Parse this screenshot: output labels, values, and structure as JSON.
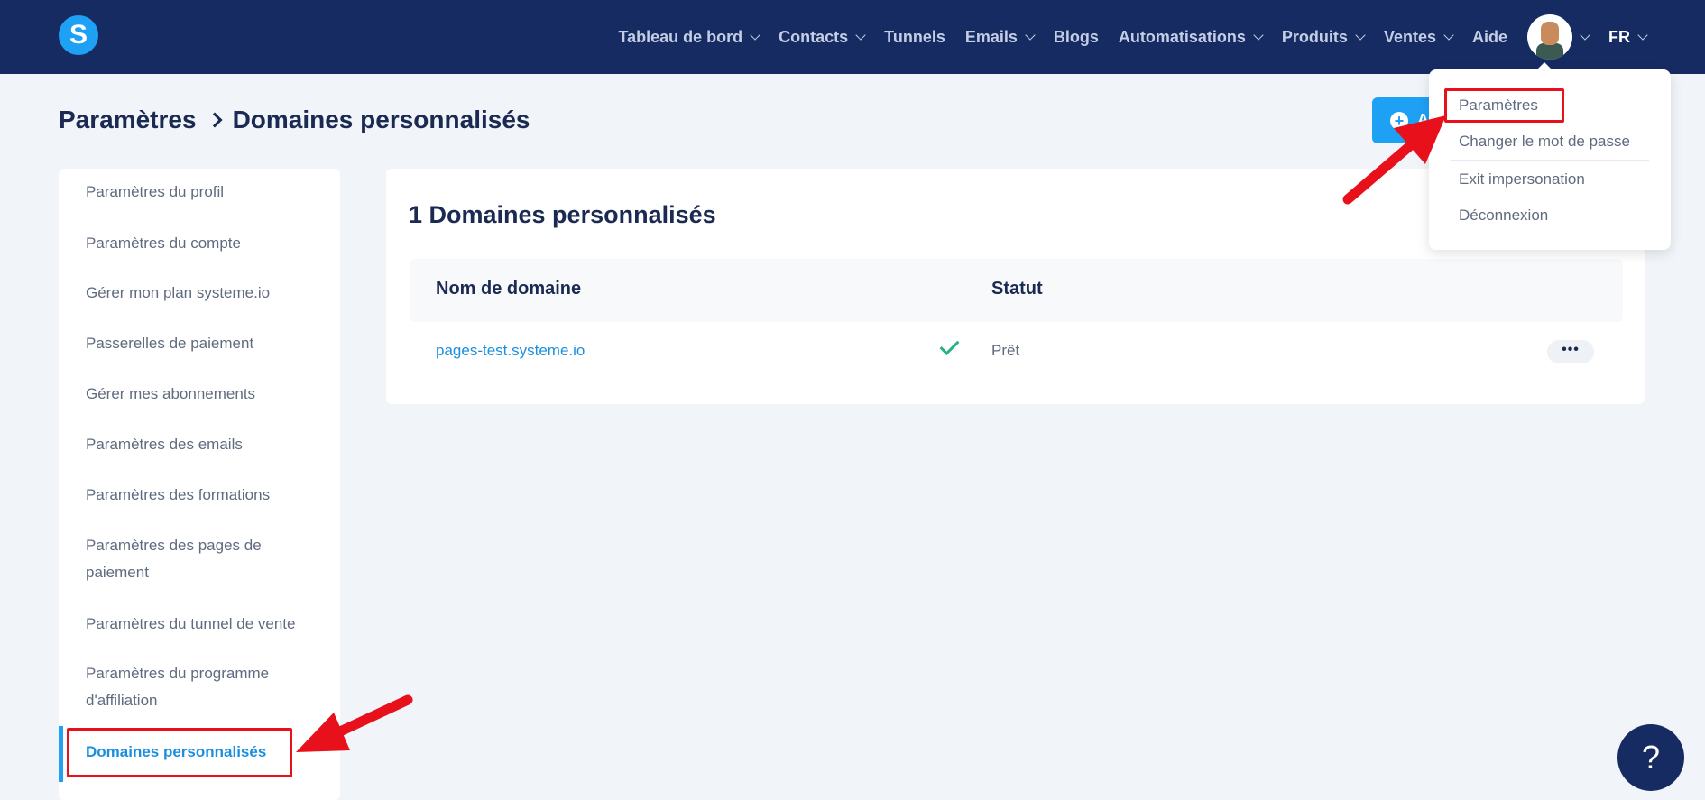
{
  "nav": {
    "logo": "S",
    "items": [
      {
        "label": "Tableau de bord",
        "dropdown": true
      },
      {
        "label": "Contacts",
        "dropdown": true
      },
      {
        "label": "Tunnels",
        "dropdown": false
      },
      {
        "label": "Emails",
        "dropdown": true
      },
      {
        "label": "Blogs",
        "dropdown": false
      },
      {
        "label": "Automatisations",
        "dropdown": true
      },
      {
        "label": "Produits",
        "dropdown": true
      },
      {
        "label": "Ventes",
        "dropdown": true
      },
      {
        "label": "Aide",
        "dropdown": false
      }
    ],
    "language": "FR"
  },
  "breadcrumb": {
    "parent": "Paramètres",
    "current": "Domaines personnalisés"
  },
  "add_button": {
    "label": "A"
  },
  "sidebar": {
    "items": [
      {
        "label": "Paramètres du profil"
      },
      {
        "label": "Paramètres du compte"
      },
      {
        "label": "Gérer mon plan systeme.io"
      },
      {
        "label": "Passerelles de paiement"
      },
      {
        "label": "Gérer mes abonnements"
      },
      {
        "label": "Paramètres des emails"
      },
      {
        "label": "Paramètres des formations"
      },
      {
        "label": "Paramètres des pages de paiement"
      },
      {
        "label": "Paramètres du tunnel de vente"
      },
      {
        "label": "Paramètres du programme d'affiliation"
      },
      {
        "label": "Domaines personnalisés",
        "active": true
      }
    ]
  },
  "main": {
    "title": "1 Domaines personnalisés",
    "columns": [
      "Nom de domaine",
      "Statut"
    ],
    "rows": [
      {
        "domain": "pages-test.systeme.io",
        "status": "Prêt",
        "actions": "•••"
      }
    ]
  },
  "user_menu": {
    "items": [
      "Paramètres",
      "Changer le mot de passe",
      "Exit impersonation",
      "Déconnexion"
    ]
  },
  "help": {
    "label": "?"
  },
  "colors": {
    "nav_bg": "#172b63",
    "accent": "#1ea0f5",
    "annotation": "#e8101a",
    "success": "#24b47e"
  }
}
